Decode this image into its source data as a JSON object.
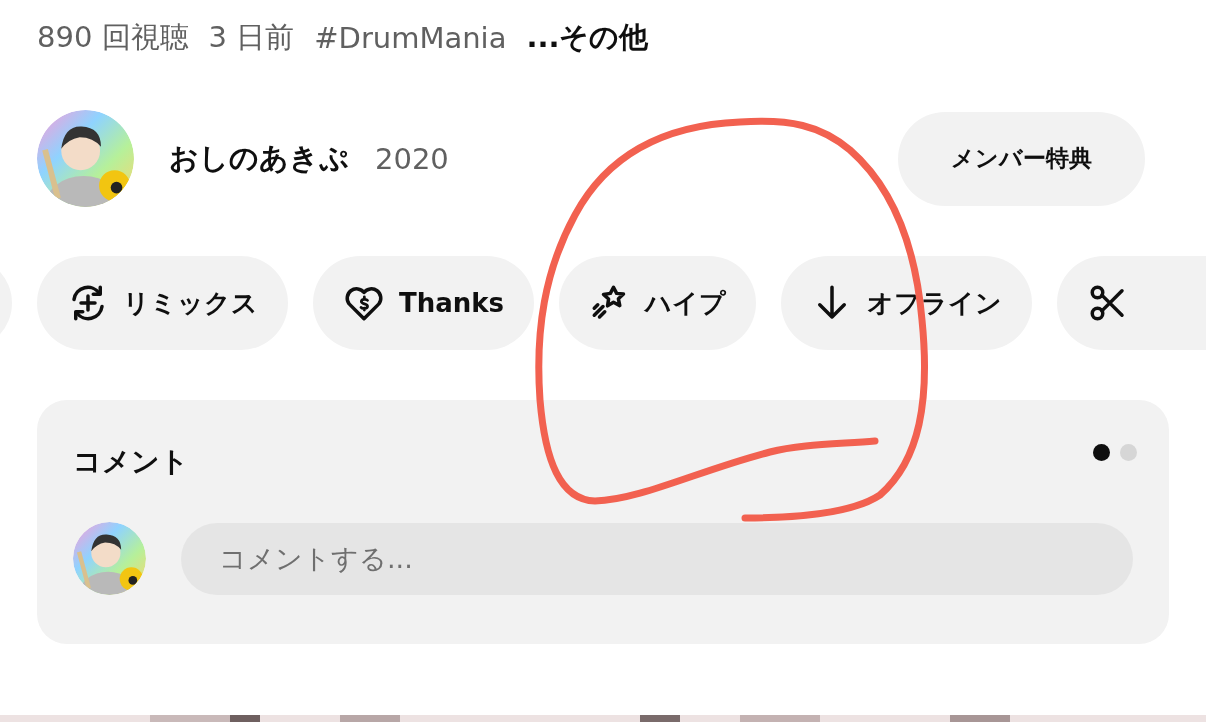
{
  "meta": {
    "views": "890 回視聴",
    "age": "3 日前",
    "hashtag": "#DrumMania",
    "more": "...その他"
  },
  "channel": {
    "name": "おしのあきぷ",
    "count": "2020"
  },
  "member_button": "メンバー特典",
  "actions": [
    {
      "kind": "edge"
    },
    {
      "kind": "remix",
      "label": "リミックス"
    },
    {
      "kind": "thanks",
      "label": "Thanks"
    },
    {
      "kind": "hype",
      "label": "ハイプ"
    },
    {
      "kind": "download",
      "label": "オフライン"
    },
    {
      "kind": "clip"
    }
  ],
  "comments": {
    "title": "コメント",
    "pages": [
      {
        "selected": true
      },
      {
        "selected": false
      }
    ],
    "placeholder": "コメントする..."
  }
}
